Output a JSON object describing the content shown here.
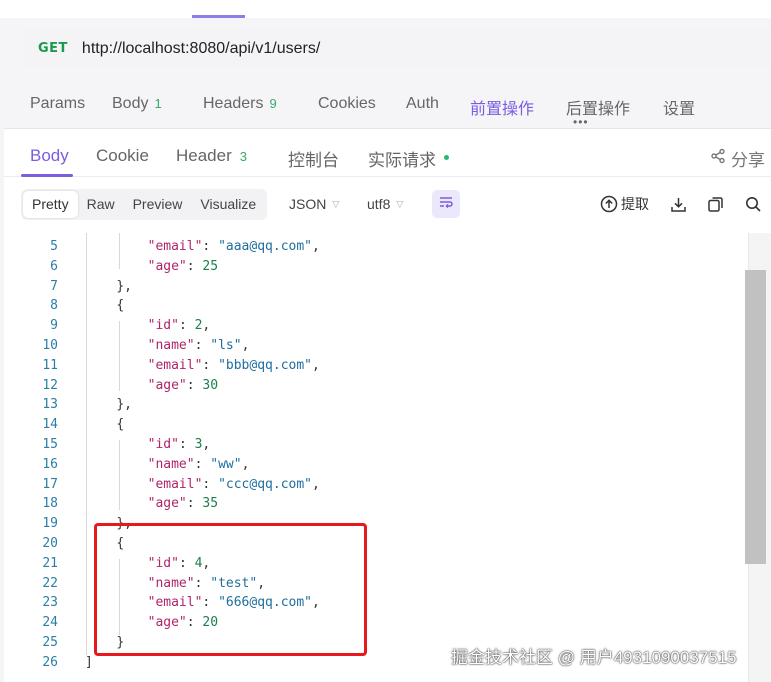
{
  "request": {
    "method": "GET",
    "url": "http://localhost:8080/api/v1/users/"
  },
  "request_tabs": [
    {
      "label": "Params",
      "count": ""
    },
    {
      "label": "Body",
      "count": "1"
    },
    {
      "label": "Headers",
      "count": "9"
    },
    {
      "label": "Cookies",
      "count": ""
    },
    {
      "label": "Auth",
      "count": ""
    },
    {
      "label": "前置操作",
      "count": "",
      "active": true
    },
    {
      "label": "后置操作",
      "count": ""
    },
    {
      "label": "设置",
      "count": ""
    }
  ],
  "response_tabs": [
    {
      "label": "Body",
      "count": "",
      "active": true
    },
    {
      "label": "Cookie",
      "count": ""
    },
    {
      "label": "Header",
      "count": "3"
    },
    {
      "label": "控制台",
      "count": ""
    },
    {
      "label": "实际请求",
      "count": ""
    }
  ],
  "share_label": "分享",
  "view_modes": [
    "Pretty",
    "Raw",
    "Preview",
    "Visualize"
  ],
  "active_view_mode": "Pretty",
  "format_select": "JSON",
  "encoding_select": "utf8",
  "extract_label": "提取",
  "code_lines": [
    {
      "n": "5",
      "indent": 8,
      "tokens": [
        [
          "k",
          "\"email\""
        ],
        [
          "p",
          ": "
        ],
        [
          "s",
          "\"aaa@qq.com\""
        ],
        [
          "p",
          ","
        ]
      ]
    },
    {
      "n": "6",
      "indent": 8,
      "tokens": [
        [
          "k",
          "\"age\""
        ],
        [
          "p",
          ": "
        ],
        [
          "n",
          "25"
        ]
      ]
    },
    {
      "n": "7",
      "indent": 4,
      "tokens": [
        [
          "p",
          "},"
        ]
      ]
    },
    {
      "n": "8",
      "indent": 4,
      "tokens": [
        [
          "p",
          "{"
        ]
      ]
    },
    {
      "n": "9",
      "indent": 8,
      "tokens": [
        [
          "k",
          "\"id\""
        ],
        [
          "p",
          ": "
        ],
        [
          "n",
          "2"
        ],
        [
          "p",
          ","
        ]
      ]
    },
    {
      "n": "10",
      "indent": 8,
      "tokens": [
        [
          "k",
          "\"name\""
        ],
        [
          "p",
          ": "
        ],
        [
          "s",
          "\"ls\""
        ],
        [
          "p",
          ","
        ]
      ]
    },
    {
      "n": "11",
      "indent": 8,
      "tokens": [
        [
          "k",
          "\"email\""
        ],
        [
          "p",
          ": "
        ],
        [
          "s",
          "\"bbb@qq.com\""
        ],
        [
          "p",
          ","
        ]
      ]
    },
    {
      "n": "12",
      "indent": 8,
      "tokens": [
        [
          "k",
          "\"age\""
        ],
        [
          "p",
          ": "
        ],
        [
          "n",
          "30"
        ]
      ]
    },
    {
      "n": "13",
      "indent": 4,
      "tokens": [
        [
          "p",
          "},"
        ]
      ]
    },
    {
      "n": "14",
      "indent": 4,
      "tokens": [
        [
          "p",
          "{"
        ]
      ]
    },
    {
      "n": "15",
      "indent": 8,
      "tokens": [
        [
          "k",
          "\"id\""
        ],
        [
          "p",
          ": "
        ],
        [
          "n",
          "3"
        ],
        [
          "p",
          ","
        ]
      ]
    },
    {
      "n": "16",
      "indent": 8,
      "tokens": [
        [
          "k",
          "\"name\""
        ],
        [
          "p",
          ": "
        ],
        [
          "s",
          "\"ww\""
        ],
        [
          "p",
          ","
        ]
      ]
    },
    {
      "n": "17",
      "indent": 8,
      "tokens": [
        [
          "k",
          "\"email\""
        ],
        [
          "p",
          ": "
        ],
        [
          "s",
          "\"ccc@qq.com\""
        ],
        [
          "p",
          ","
        ]
      ]
    },
    {
      "n": "18",
      "indent": 8,
      "tokens": [
        [
          "k",
          "\"age\""
        ],
        [
          "p",
          ": "
        ],
        [
          "n",
          "35"
        ]
      ]
    },
    {
      "n": "19",
      "indent": 4,
      "tokens": [
        [
          "p",
          "},"
        ]
      ]
    },
    {
      "n": "20",
      "indent": 4,
      "tokens": [
        [
          "p",
          "{"
        ]
      ]
    },
    {
      "n": "21",
      "indent": 8,
      "tokens": [
        [
          "k",
          "\"id\""
        ],
        [
          "p",
          ": "
        ],
        [
          "n",
          "4"
        ],
        [
          "p",
          ","
        ]
      ]
    },
    {
      "n": "22",
      "indent": 8,
      "tokens": [
        [
          "k",
          "\"name\""
        ],
        [
          "p",
          ": "
        ],
        [
          "s",
          "\"test\""
        ],
        [
          "p",
          ","
        ]
      ]
    },
    {
      "n": "23",
      "indent": 8,
      "tokens": [
        [
          "k",
          "\"email\""
        ],
        [
          "p",
          ": "
        ],
        [
          "s",
          "\"666@qq.com\""
        ],
        [
          "p",
          ","
        ]
      ]
    },
    {
      "n": "24",
      "indent": 8,
      "tokens": [
        [
          "k",
          "\"age\""
        ],
        [
          "p",
          ": "
        ],
        [
          "n",
          "20"
        ]
      ]
    },
    {
      "n": "25",
      "indent": 4,
      "tokens": [
        [
          "p",
          "}"
        ]
      ]
    },
    {
      "n": "26",
      "indent": 0,
      "tokens": [
        [
          "p",
          "]"
        ]
      ]
    }
  ],
  "watermark": "掘金技术社区 @ 用户4931090037515",
  "colors": {
    "accent": "#7c5ce0",
    "method_get": "#1a9a4b",
    "highlight_box": "#e8191c",
    "status_dot": "#2bb673"
  },
  "icons": [
    "share-icon",
    "wrap-lines-icon",
    "extract-icon",
    "download-icon",
    "copy-icon",
    "search-icon",
    "chevron-down-icon"
  ]
}
